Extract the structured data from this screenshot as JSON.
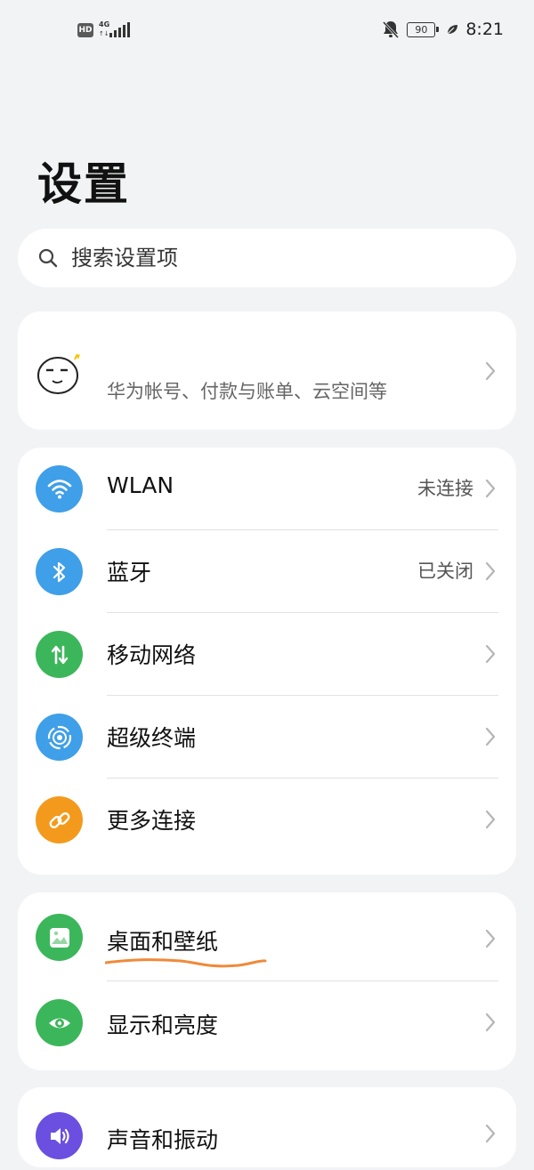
{
  "status_bar": {
    "hd_badge": "HD",
    "network_type": "4G",
    "network_arrows": "↑↓",
    "battery_level": "90",
    "time": "8:21",
    "icons": [
      "hd-icon",
      "signal-icon",
      "mute-icon",
      "battery-icon",
      "eco-leaf-icon"
    ]
  },
  "page": {
    "title": "设置"
  },
  "search": {
    "placeholder": "搜索设置项"
  },
  "account": {
    "description": "华为帐号、付款与账单、云空间等"
  },
  "connections": [
    {
      "label": "WLAN",
      "value": "未连接",
      "icon": "wifi-icon",
      "color": "#3f9fe8"
    },
    {
      "label": "蓝牙",
      "value": "已关闭",
      "icon": "bluetooth-icon",
      "color": "#3f9fe8"
    },
    {
      "label": "移动网络",
      "value": "",
      "icon": "mobile-data-icon",
      "color": "#3cb65a"
    },
    {
      "label": "超级终端",
      "value": "",
      "icon": "super-device-icon",
      "color": "#3f9fe8"
    },
    {
      "label": "更多连接",
      "value": "",
      "icon": "link-icon",
      "color": "#f39a1d"
    }
  ],
  "display": [
    {
      "label": "桌面和壁纸",
      "icon": "wallpaper-icon",
      "color": "#3cb65a"
    },
    {
      "label": "显示和亮度",
      "icon": "eye-icon",
      "color": "#3cb65a"
    }
  ],
  "sound": {
    "label": "声音和振动",
    "icon": "speaker-icon",
    "color": "#6b4fe0"
  },
  "colors": {
    "background": "#f1f3f5",
    "card": "#ffffff",
    "annotation": "#ef8a3a"
  }
}
